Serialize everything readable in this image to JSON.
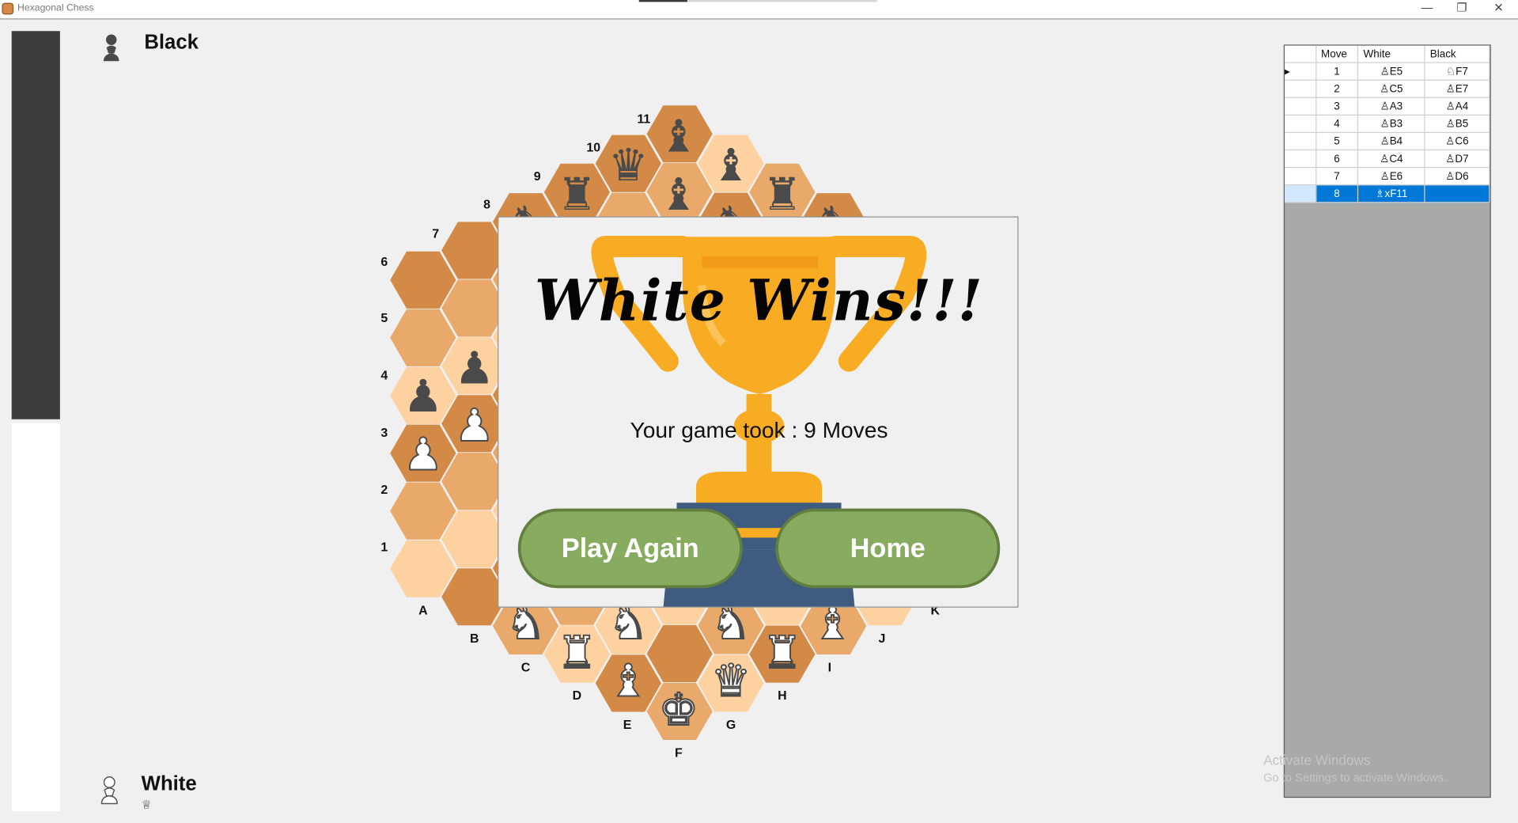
{
  "window": {
    "title": "Hexagonal Chess",
    "minimize": "—",
    "maximize": "❐",
    "close": "✕"
  },
  "players": {
    "black": {
      "name": "Black",
      "icon": "black-pawn-icon"
    },
    "white": {
      "name": "White",
      "icon": "white-pawn-icon",
      "captured": "♕"
    }
  },
  "board": {
    "file_labels": [
      "A",
      "B",
      "C",
      "D",
      "E",
      "F",
      "G",
      "H",
      "I",
      "J",
      "K"
    ],
    "rank_labels": [
      "1",
      "2",
      "3",
      "4",
      "5",
      "6",
      "7",
      "8",
      "9",
      "10",
      "11"
    ],
    "colors": {
      "light": "#fdd1a0",
      "mid": "#e8a96b",
      "dark": "#d28a46",
      "piece_dark": "#4a4a4a",
      "piece_light": "#ffffff"
    }
  },
  "moves": {
    "headers": [
      "Move",
      "White",
      "Black"
    ],
    "rows": [
      {
        "n": "1",
        "white": "♙E5",
        "black": "♘F7"
      },
      {
        "n": "2",
        "white": "♙C5",
        "black": "♙E7"
      },
      {
        "n": "3",
        "white": "♙A3",
        "black": "♙A4"
      },
      {
        "n": "4",
        "white": "♙B3",
        "black": "♙B5"
      },
      {
        "n": "5",
        "white": "♙B4",
        "black": "♙C6"
      },
      {
        "n": "6",
        "white": "♙C4",
        "black": "♙D7"
      },
      {
        "n": "7",
        "white": "♙E6",
        "black": "♙D6"
      },
      {
        "n": "8",
        "white": "♗xF11",
        "black": ""
      }
    ],
    "current_row_marker": "▸",
    "selected_color": "#0078d7"
  },
  "dialog": {
    "title": "White Wins!!!",
    "game_length": "Your game took : 9 Moves",
    "play_again": "Play Again",
    "home": "Home",
    "button_color": "#88ac5f",
    "trophy_color": "#f7ac23",
    "base_color": "#3f5b80"
  },
  "watermark": {
    "line1": "Activate Windows",
    "line2": "Go to Settings to activate Windows."
  }
}
